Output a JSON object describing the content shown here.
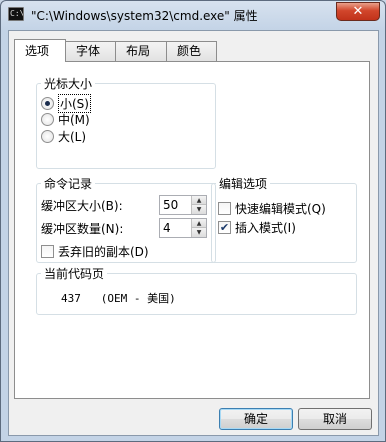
{
  "window": {
    "title": "\"C:\\Windows\\system32\\cmd.exe\" 属性",
    "icon_text": "C:\\",
    "close_icon": "✕"
  },
  "tabs": [
    "选项",
    "字体",
    "布局",
    "颜色"
  ],
  "cursor_size": {
    "legend": "光标大小",
    "options": [
      "小(S)",
      "中(M)",
      "大(L)"
    ],
    "selected": "小(S)"
  },
  "command_history": {
    "legend": "命令记录",
    "buffer_size_label": "缓冲区大小(B):",
    "buffer_size_value": "50",
    "buffer_count_label": "缓冲区数量(N):",
    "buffer_count_value": "4",
    "discard_label": "丢弃旧的副本(D)",
    "discard_checked": false
  },
  "edit_options": {
    "legend": "编辑选项",
    "quick_edit_label": "快速编辑模式(Q)",
    "quick_edit_checked": false,
    "insert_mode_label": "插入模式(I)",
    "insert_mode_checked": true
  },
  "code_page": {
    "legend": "当前代码页",
    "value": "437   (OEM - 美国)"
  },
  "buttons": {
    "ok": "确定",
    "cancel": "取消"
  },
  "icons": {
    "check": "✔",
    "spin_up": "▲",
    "spin_down": "▼"
  }
}
